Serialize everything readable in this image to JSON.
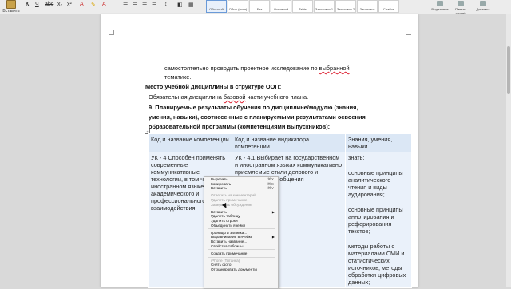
{
  "ribbon": {
    "paste_label": "Вставить",
    "format_buttons": [
      "К",
      "Ч",
      "abc",
      "x₂",
      "x²"
    ],
    "styles": [
      {
        "label": "Обычный",
        "selected": true
      },
      {
        "label": "Обыч (пока)",
        "selected": false
      },
      {
        "label": "Без интерва…",
        "selected": false
      },
      {
        "label": "Основной т…",
        "selected": false
      },
      {
        "label": "Table Paragr…",
        "selected": false
      },
      {
        "label": "Заголовок 1",
        "selected": false
      },
      {
        "label": "Заголовок 2",
        "selected": false
      },
      {
        "label": "Заголовок",
        "selected": false
      },
      {
        "label": "Слабое выд…",
        "selected": false
      }
    ],
    "right_tools": [
      "Выделение",
      "Панель стилей",
      "Диктовка"
    ]
  },
  "document": {
    "bullet_dash": "–",
    "bullet_line1_a": "самостоятельно проводить проектное исследование по ",
    "bullet_line1_b": "выбранной",
    "bullet_line2": "тематике.",
    "section_heading": "Место учебной дисциплины в структуре ООП:",
    "section_text_a": "Обязательная дисциплина ",
    "section_text_b": "базовой",
    "section_text_c": " части учебного плана.",
    "item9_line1": "9.   Планируемые результаты обучения по дисциплине/модулю (знания,",
    "item9_line2": "умения, навыки), соотнесенные с планируемыми результатами освоения",
    "item9_line3": "образовательной программы (компетенциями выпускников):"
  },
  "table": {
    "headers": [
      "Код и название компетенции",
      "Код и название индикатора компетенции",
      "Знания, умения, навыки"
    ],
    "col1": "УК - 4 Способен применять современные коммуникативные технологии, в том числе на иностранном языке, для академического и профессионального взаимодействия",
    "col2": "УК - 4.1 Выбирает на государственном и иностранном языках коммуникативно приемлемые стили делового и академического общения",
    "col3_title": "знать:",
    "col3_items": [
      "основные принципы аналитического чтения и виды аудирования;",
      "основные принципы аннотирования и реферирования текстов;",
      "методы работы с материалами СМИ и статистических источников; методы обработки цифровых данных;"
    ]
  },
  "context_menu": {
    "groups": [
      [
        {
          "label": "Вырезать",
          "shortcut": "⌘X",
          "disabled": false,
          "submenu": false
        },
        {
          "label": "Копировать",
          "shortcut": "⌘C",
          "disabled": false,
          "submenu": false
        },
        {
          "label": "Вставить",
          "shortcut": "⌘V",
          "disabled": false,
          "submenu": false
        }
      ],
      [
        {
          "label": "Ответить на комментарий",
          "shortcut": "",
          "disabled": true,
          "submenu": false
        },
        {
          "label": "Удалить примечание",
          "shortcut": "",
          "disabled": true,
          "submenu": false
        },
        {
          "label": "Завершить обсуждение",
          "shortcut": "",
          "disabled": true,
          "submenu": false
        }
      ],
      [
        {
          "label": "Вставить",
          "shortcut": "",
          "disabled": false,
          "submenu": true
        },
        {
          "label": "Удалить таблицу",
          "shortcut": "",
          "disabled": false,
          "submenu": false
        },
        {
          "label": "Удалить строки",
          "shortcut": "",
          "disabled": false,
          "submenu": false
        },
        {
          "label": "Объединить ячейки",
          "shortcut": "",
          "disabled": false,
          "submenu": false
        }
      ],
      [
        {
          "label": "Границы и заливка...",
          "shortcut": "",
          "disabled": false,
          "submenu": false
        },
        {
          "label": "Выравнивание в ячейке",
          "shortcut": "",
          "disabled": false,
          "submenu": true
        },
        {
          "label": "Вставить название...",
          "shortcut": "",
          "disabled": false,
          "submenu": false
        },
        {
          "label": "Свойства таблицы...",
          "shortcut": "",
          "disabled": false,
          "submenu": false
        }
      ],
      [
        {
          "label": "Создать примечание",
          "shortcut": "",
          "disabled": false,
          "submenu": false
        }
      ],
      [
        {
          "label": "iPhone (Титанка)",
          "shortcut": "",
          "disabled": true,
          "submenu": false
        },
        {
          "label": "Снять фото",
          "shortcut": "",
          "disabled": false,
          "submenu": false
        },
        {
          "label": "Отсканировать документы",
          "shortcut": "",
          "disabled": false,
          "submenu": false
        }
      ]
    ]
  }
}
